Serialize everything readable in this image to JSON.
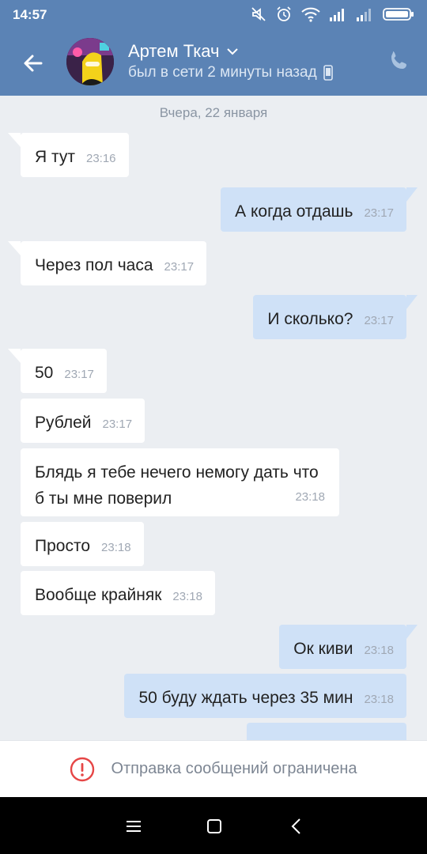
{
  "status_bar": {
    "time": "14:57"
  },
  "header": {
    "contact_name": "Артем Ткач",
    "contact_status": "был в сети 2 минуты назад"
  },
  "chat": {
    "date_separator": "Вчера, 22 января",
    "messages": [
      {
        "direction": "in",
        "text": "Я тут",
        "time": "23:16"
      },
      {
        "direction": "out",
        "text": "А когда отдашь",
        "time": "23:17"
      },
      {
        "direction": "in",
        "text": "Через пол часа",
        "time": "23:17"
      },
      {
        "direction": "out",
        "text": "И сколько?",
        "time": "23:17"
      },
      {
        "direction": "in",
        "text": "50",
        "time": "23:17"
      },
      {
        "direction": "in",
        "text": "Рублей",
        "time": "23:17"
      },
      {
        "direction": "in",
        "text": "Блядь я тебе нечего немогу дать что б ты мне поверил",
        "time": "23:18"
      },
      {
        "direction": "in",
        "text": "Просто",
        "time": "23:18"
      },
      {
        "direction": "in",
        "text": "Вообще крайняк",
        "time": "23:18"
      },
      {
        "direction": "out",
        "text": "Ок киви",
        "time": "23:18"
      },
      {
        "direction": "out",
        "text": "50 буду ждать через 35 мин",
        "time": "23:18"
      }
    ]
  },
  "restriction_notice": "Отправка сообщений ограничена",
  "colors": {
    "header_bg": "#5b83b5",
    "chat_bg": "#ebeef2",
    "incoming_bubble": "#ffffff",
    "outgoing_bubble": "#cfe1f7",
    "warning_red": "#e64646"
  },
  "icons": {
    "status": [
      "mute-icon",
      "alarm-icon",
      "wifi-icon",
      "signal-icon",
      "signal-icon",
      "battery-icon"
    ],
    "appbar": [
      "back-arrow-icon",
      "chevron-down-icon",
      "phone-device-icon",
      "call-icon"
    ],
    "notice": "warning-icon",
    "nav": [
      "menu-icon",
      "home-icon",
      "back-icon"
    ]
  }
}
